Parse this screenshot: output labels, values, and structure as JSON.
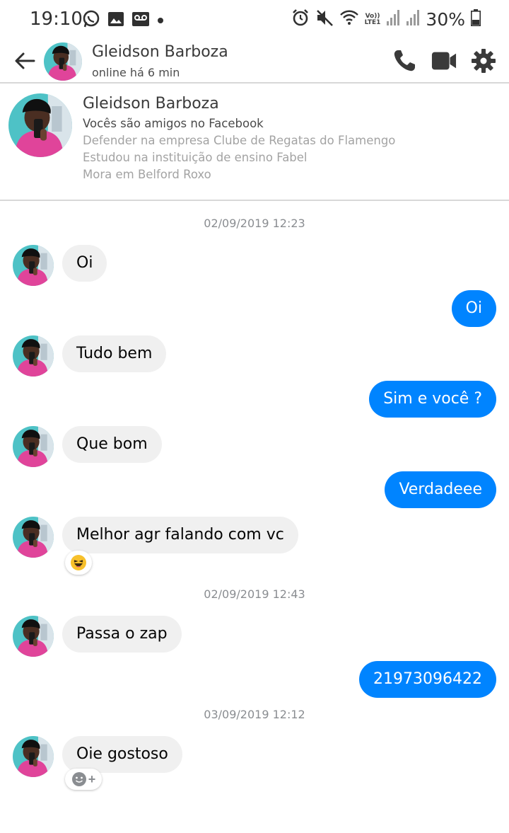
{
  "status_bar": {
    "time": "19:10",
    "battery": "30%",
    "network": "LTE1",
    "volte": "Vo))",
    "left_icons": [
      "whatsapp-icon",
      "gallery-icon",
      "voicemail-icon",
      "dot-icon"
    ],
    "right_icons": [
      "alarm-icon",
      "mute-icon",
      "wifi-icon",
      "signal-icon",
      "signal-icon",
      "battery-icon"
    ]
  },
  "header": {
    "name": "Gleidson Barboza",
    "status": "online há 6 min"
  },
  "profile": {
    "name": "Gleidson Barboza",
    "friends": "Vocês são amigos no Facebook",
    "work": "Defender na empresa Clube de Regatas do Flamengo",
    "education": "Estudou na instituição de ensino Fabel",
    "home": "Mora em Belford Roxo"
  },
  "colors": {
    "accent": "#0084ff",
    "incoming_bubble": "#f0f0f0",
    "avatar_shirt": "#e0449a",
    "avatar_bg": "#4ec2c6"
  },
  "timestamps": [
    "02/09/2019 12:23",
    "02/09/2019 12:43",
    "03/09/2019 12:12"
  ],
  "messages": [
    {
      "from": "them",
      "text": "Oi"
    },
    {
      "from": "me",
      "text": "Oi"
    },
    {
      "from": "them",
      "text": "Tudo bem"
    },
    {
      "from": "me",
      "text": "Sim e você ?"
    },
    {
      "from": "them",
      "text": "Que bom"
    },
    {
      "from": "me",
      "text": "Verdadeee"
    },
    {
      "from": "them",
      "text": "Melhor agr falando com vc",
      "reaction": "laughing-emoji-icon"
    },
    {
      "from": "them",
      "text": "Passa o zap"
    },
    {
      "from": "me",
      "text": "21973096422"
    },
    {
      "from": "them",
      "text": "Oie gostoso",
      "reaction_add": "add-reaction-icon"
    }
  ]
}
